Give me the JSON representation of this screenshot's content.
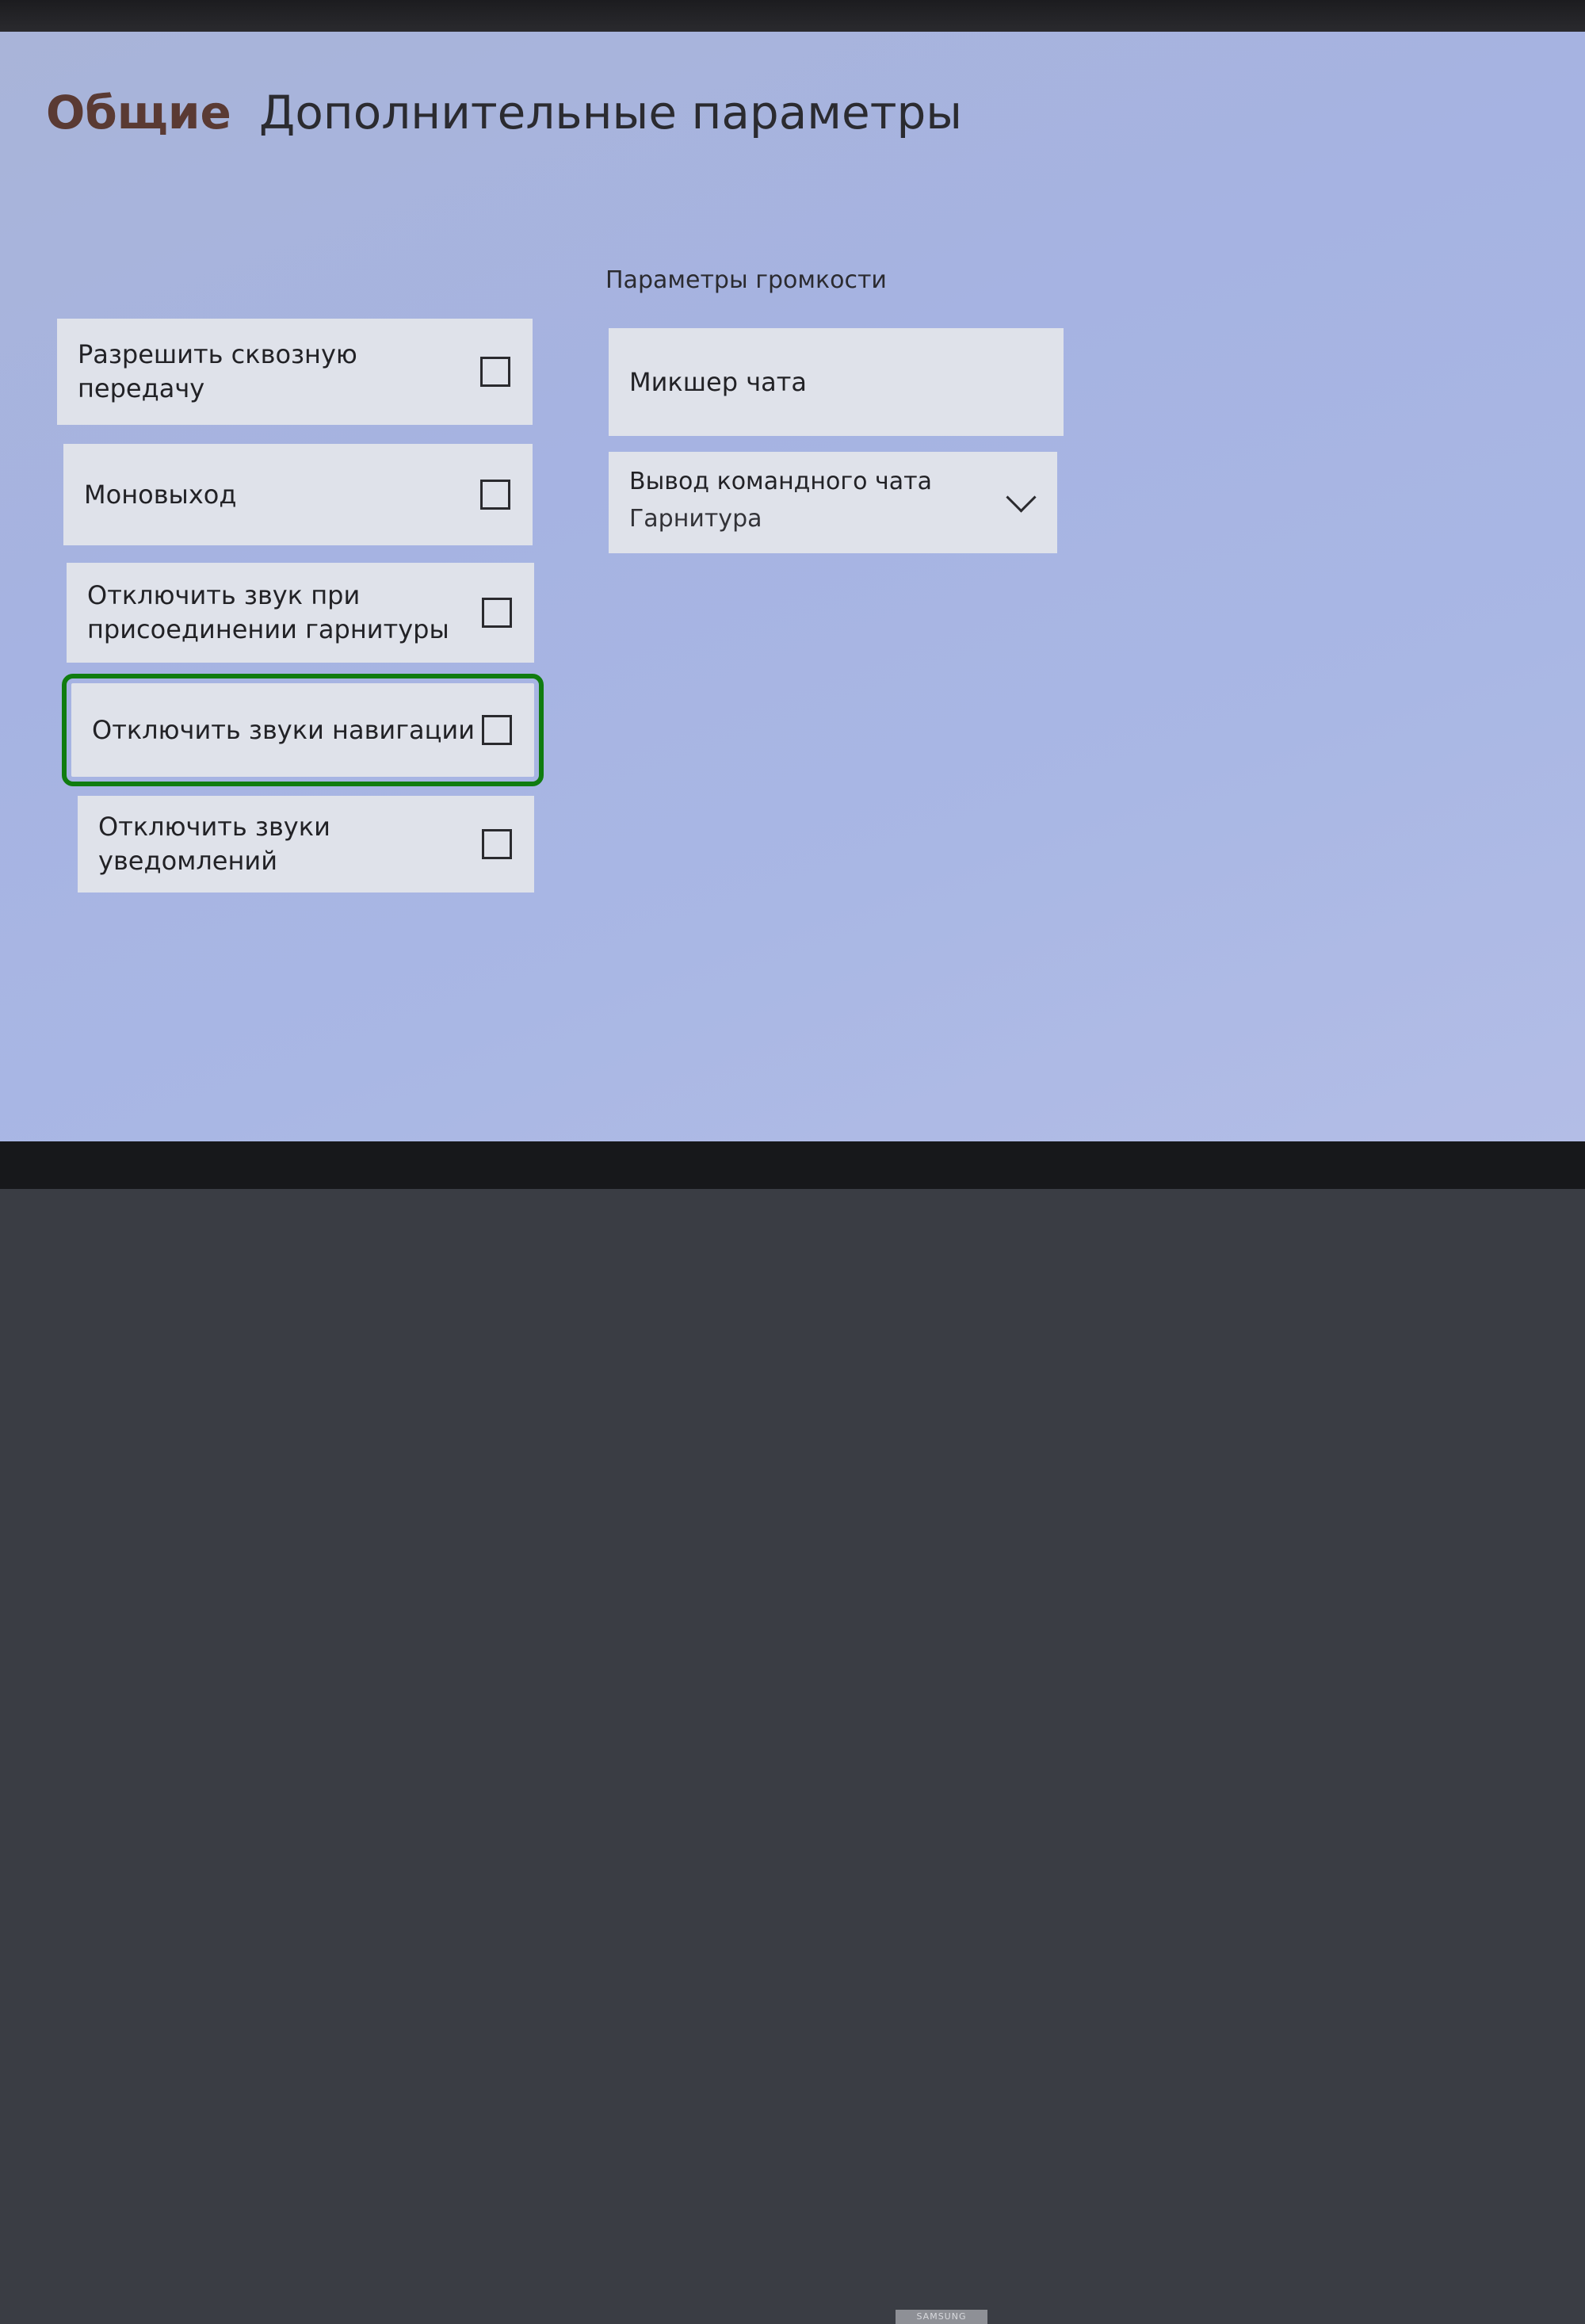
{
  "header": {
    "section": "Общие",
    "title": "Дополнительные параметры"
  },
  "toggles": [
    {
      "label": "Разрешить сквозную передачу",
      "checked": false
    },
    {
      "label": "Моновыход",
      "checked": false
    },
    {
      "label": "Отключить звук при присоединении гарнитуры",
      "checked": false
    },
    {
      "label": "Отключить звуки навигации",
      "checked": false,
      "focused": true
    },
    {
      "label": "Отключить звуки уведомлений",
      "checked": false
    }
  ],
  "volume": {
    "title": "Параметры громкости",
    "mixer_label": "Микшер чата",
    "team_chat": {
      "label": "Вывод командного чата",
      "value": "Гарнитура"
    }
  },
  "tv_brand": "SAMSUNG",
  "colors": {
    "focus": "#107c10",
    "background": "#a8b5e2",
    "card": "#dfe2ea",
    "section_title": "#5a3a33"
  },
  "icons": {
    "checkbox": "empty-square",
    "dropdown": "chevron-down"
  }
}
